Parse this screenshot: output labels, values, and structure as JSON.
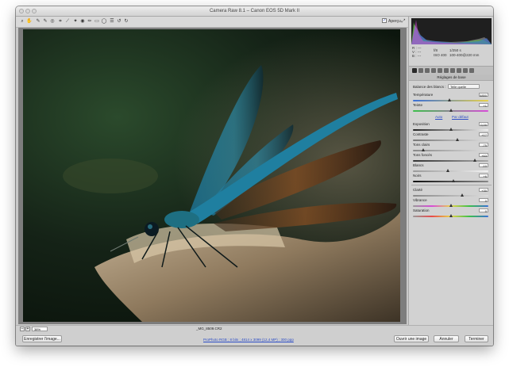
{
  "window": {
    "title": "Camera Raw 8.1  –  Canon EOS 5D Mark II"
  },
  "toolbar": {
    "preview_label": "Aperçu",
    "tools": [
      "zoom-icon",
      "hand-icon",
      "eyedropper-icon",
      "color-sampler-icon",
      "target-adjust-icon",
      "crop-icon",
      "straighten-icon",
      "spot-removal-icon",
      "red-eye-icon",
      "adjust-brush-icon",
      "graduated-filter-icon",
      "radial-filter-icon",
      "preferences-icon",
      "rotate-left-icon",
      "rotate-right-icon"
    ]
  },
  "camera_info": {
    "r": "R :",
    "g": "V :",
    "b": "B :",
    "rgb_r": "---",
    "rgb_g": "---",
    "rgb_b": "---",
    "aperture": "f/8",
    "shutter": "1/250 s",
    "iso": "ISO 400",
    "lens": "100-400@220 mm"
  },
  "panel": {
    "section_title": "Réglages de base",
    "wb_label": "Balance des blancs :",
    "wb_value": "Telle quelle",
    "temperature": {
      "label": "Température",
      "value": "4850"
    },
    "tint": {
      "label": "Teinte",
      "value": "+1"
    },
    "auto": "Auto",
    "default": "Par défaut",
    "exposure": {
      "label": "Exposition",
      "value": "0,00"
    },
    "contrast": {
      "label": "Contraste",
      "value": "+17"
    },
    "highlights": {
      "label": "Tons clairs",
      "value": "-75"
    },
    "shadows": {
      "label": "Tons foncés",
      "value": "+63"
    },
    "whites": {
      "label": "Blancs",
      "value": "-10"
    },
    "blacks": {
      "label": "Noirs",
      "value": "+6"
    },
    "clarity": {
      "label": "Clarté",
      "value": "+30"
    },
    "vibrance": {
      "label": "Vibrance",
      "value": "0"
    },
    "saturation": {
      "label": "Saturation",
      "value": "0"
    }
  },
  "statusbar": {
    "zoom": "38%",
    "filename": "_MG_8509.CR2",
    "workflow": "ProPhoto RGB ; 8 bits ; 4814 x 3099 (12,4 MP) ; 300 ppp",
    "save_button": "Enregistrer l'image...",
    "open_button": "Ouvrir une image",
    "cancel_button": "Annuler",
    "done_button": "Terminer"
  },
  "colors": {
    "accent": "#2b4cc6",
    "dragonfly": "#1f7fa0",
    "background": "#152317"
  }
}
